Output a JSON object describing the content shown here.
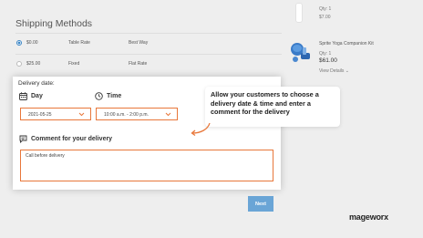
{
  "shipping": {
    "title": "Shipping Methods",
    "rows": [
      {
        "price": "$0.00",
        "method": "Table Rate",
        "carrier": "Best Way",
        "selected": true
      },
      {
        "price": "$25.00",
        "method": "Fixed",
        "carrier": "Flat Rate",
        "selected": false
      }
    ]
  },
  "summary": {
    "item1_qty": "Qty: 1",
    "item1_price": "$7.00",
    "item2_name": "Sprite Yoga Companion Kit",
    "item2_qty": "Qty: 1",
    "item2_price": "$61.00",
    "view_details": "View Details ⌄"
  },
  "delivery": {
    "title": "Delivery date:",
    "day_label": "Day",
    "time_label": "Time",
    "day_value": "2021-05-25",
    "time_value": "10:00 a.m. - 2:00 p.m.",
    "comment_label": "Comment for your delivery",
    "comment_value": "Call before delivery"
  },
  "callout": {
    "text": "Allow your customers to choose a delivery date & time and enter a comment for the delivery"
  },
  "next_label": "Next",
  "brand": "mageworx",
  "colors": {
    "accent_orange": "#e8773a",
    "button_blue": "#6aa5d6",
    "radio_blue": "#3b86c6"
  }
}
